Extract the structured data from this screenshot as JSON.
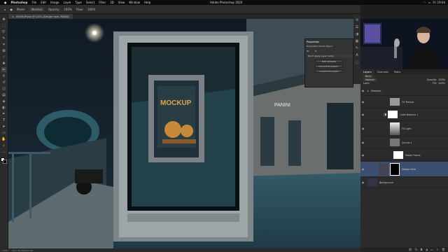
{
  "menubar": {
    "apple": "",
    "app_name": "Photoshop",
    "items": [
      "File",
      "Edit",
      "Image",
      "Layer",
      "Type",
      "Select",
      "Filter",
      "3D",
      "View",
      "Window",
      "Help"
    ],
    "center_title": "Adobe Photoshop 2020",
    "clock": "Fri 19:04"
  },
  "options_bar": {
    "mode_label": "Mode:",
    "mode_value": "Normal",
    "opacity_label": "Opacity:",
    "opacity_value": "100%",
    "flow_label": "Flow:",
    "flow_value": "100%"
  },
  "document_tab": {
    "title": "MOCKUP.psd @ 100% (Design here, RGB/8)",
    "close": "×"
  },
  "canvas": {
    "poster_text": "MOCKUP",
    "shop_sign": "PANINI"
  },
  "properties_panel": {
    "title": "Properties",
    "subtitle": "Embedded Smart Object",
    "w_label": "W:",
    "h_label": "H:",
    "layer_comp": "Don't Apply Layer Comp",
    "btn_edit": "Edit Contents",
    "btn_convert_linked": "Convert to Linked...",
    "btn_convert_layers": "Convert to Layers"
  },
  "status_bar": {
    "zoom": "100%",
    "doc_info": "Doc: 45.2M/212.3M"
  },
  "panels": {
    "tabs": [
      "Layers",
      "Channels",
      "Paths"
    ],
    "kind_label": "Kind",
    "blend_mode": "Normal",
    "opacity_label": "Opacity:",
    "opacity_value": "100%",
    "lock_label": "Lock:",
    "fill_label": "Fill:",
    "fill_value": "100%",
    "layers": [
      {
        "name": "Shadows",
        "thumb": "#666"
      },
      {
        "name": "Background",
        "thumb": "#666"
      },
      {
        "name": "FX Texture",
        "thumb": "#999"
      },
      {
        "name": "Color Balance 1",
        "thumb": "#555"
      },
      {
        "name": "FX Light",
        "thumb": "#ccc"
      },
      {
        "name": "Curves 1",
        "thumb": "#777"
      },
      {
        "name": "Poster Frame",
        "thumb": "#fff"
      },
      {
        "name": "Design here",
        "thumb": "#445"
      },
      {
        "name": "Background",
        "thumb": "#334"
      }
    ]
  },
  "colors": {
    "accent": "#3d4f70",
    "panel_bg": "#2b2b2b",
    "canvas_bg": "#0d1820"
  }
}
